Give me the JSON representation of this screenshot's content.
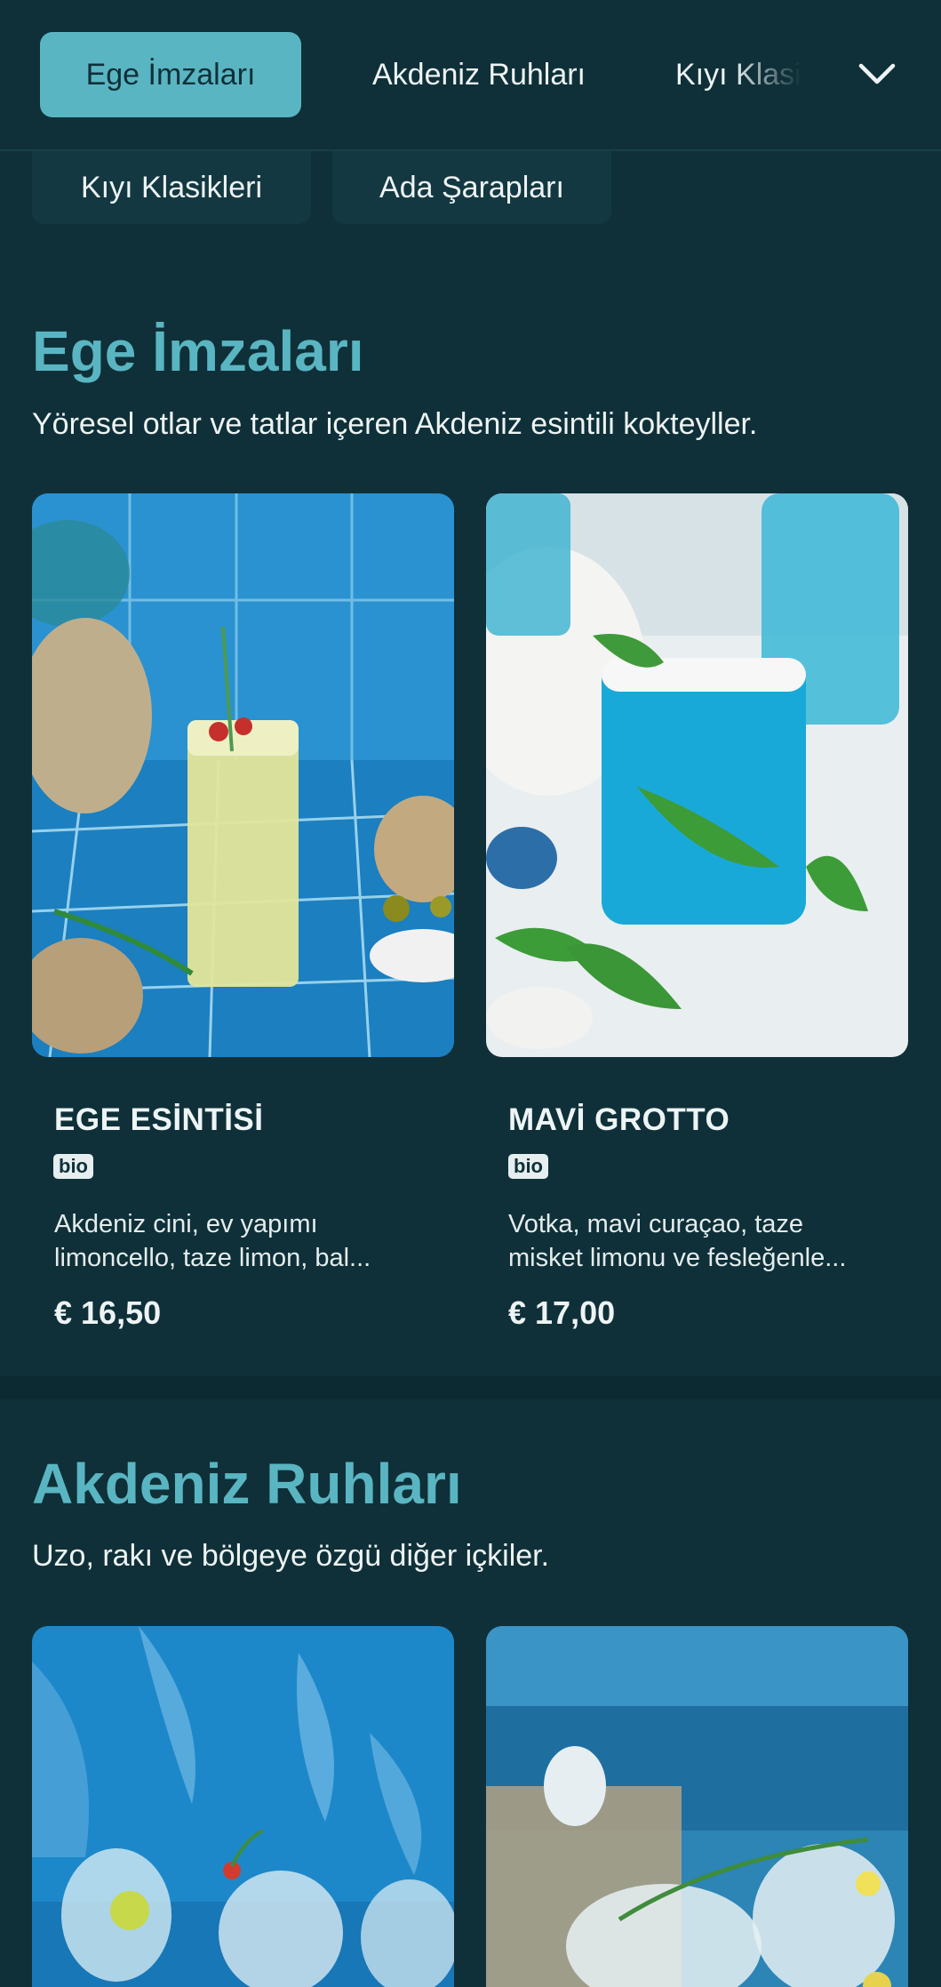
{
  "tabs": [
    {
      "label": "Ege İmzaları",
      "active": true
    },
    {
      "label": "Akdeniz Ruhları",
      "active": false
    },
    {
      "label": "Kıyı Klasi",
      "active": false
    }
  ],
  "chips": [
    "Kıyı Klasikleri",
    "Ada Şarapları"
  ],
  "sections": [
    {
      "title": "Ege İmzaları",
      "description": "Yöresel otlar ve tatlar içeren Akdeniz esintili kokteyller.",
      "items": [
        {
          "name": "EGE ESİNTİSİ",
          "badge": "bio",
          "description": "Akdeniz cini, ev yapımı limoncello, taze limon, bal...",
          "price": "€ 16,50"
        },
        {
          "name": "MAVİ GROTTO",
          "badge": "bio",
          "description": "Votka, mavi curaçao, taze misket limonu ve fesleğenle...",
          "price": "€ 17,00"
        }
      ]
    },
    {
      "title": "Akdeniz Ruhları",
      "description": "Uzo, rakı ve bölgeye özgü diğer içkiler."
    }
  ],
  "icons": {
    "menu_toggle": "chevron-down-icon"
  },
  "colors": {
    "background": "#0f3038",
    "accent": "#5ab5c2",
    "surface": "#133841"
  }
}
